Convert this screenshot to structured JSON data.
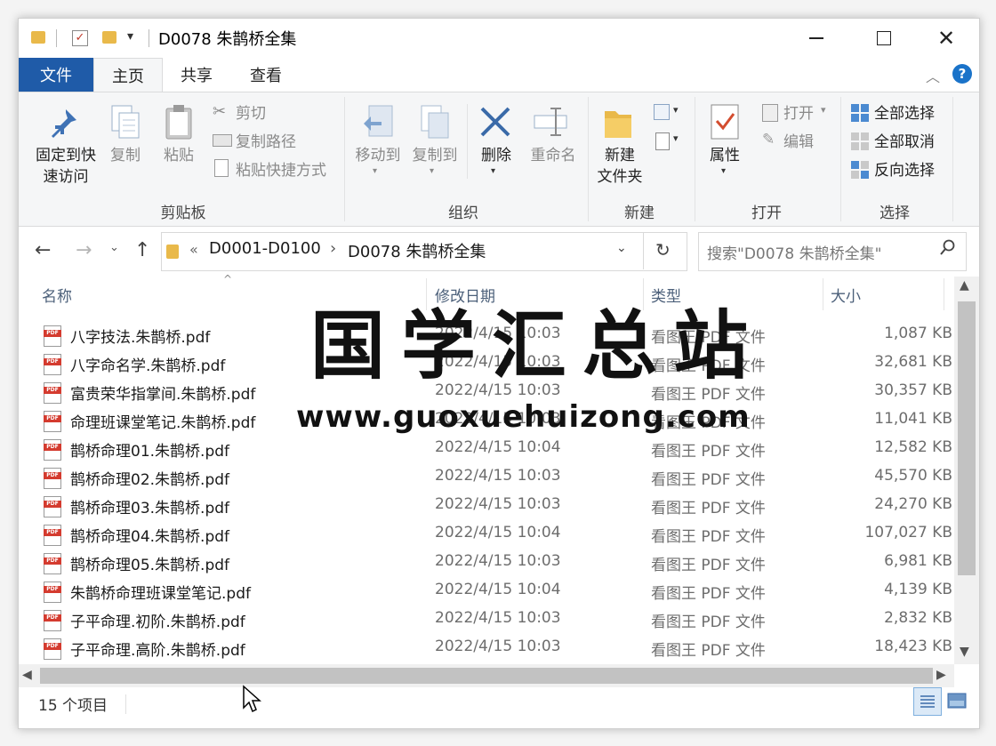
{
  "window": {
    "title": "D0078 朱鹊桥全集"
  },
  "ribbon_tabs": {
    "file": "文件",
    "home": "主页",
    "share": "共享",
    "view": "查看"
  },
  "ribbon": {
    "clipboard": {
      "pin": "固定到快速访问",
      "pin_line1": "固定到快",
      "pin_line2": "速访问",
      "copy": "复制",
      "paste": "粘贴",
      "cut": "剪切",
      "copy_path": "复制路径",
      "paste_shortcut": "粘贴快捷方式",
      "label": "剪贴板"
    },
    "organize": {
      "move_to": "移动到",
      "copy_to": "复制到",
      "delete": "删除",
      "rename": "重命名",
      "label": "组织"
    },
    "new": {
      "new_folder_line1": "新建",
      "new_folder_line2": "文件夹",
      "label": "新建"
    },
    "open": {
      "properties": "属性",
      "open": "打开",
      "edit": "编辑",
      "label": "打开"
    },
    "select": {
      "select_all": "全部选择",
      "select_none": "全部取消",
      "invert": "反向选择",
      "label": "选择"
    }
  },
  "address": {
    "overflow": "«",
    "crumb1": "D0001-D0100",
    "sep": "›",
    "crumb2": "D0078 朱鹊桥全集",
    "search_placeholder": "搜索\"D0078 朱鹊桥全集\""
  },
  "columns": {
    "name": "名称",
    "date": "修改日期",
    "type": "类型",
    "size": "大小"
  },
  "files": [
    {
      "name": "八字技法.朱鹊桥.pdf",
      "date": "2022/4/15 10:03",
      "type": "看图王 PDF 文件",
      "size": "1,087 KB"
    },
    {
      "name": "八字命名学.朱鹊桥.pdf",
      "date": "2022/4/15 10:03",
      "type": "看图王 PDF 文件",
      "size": "32,681 KB"
    },
    {
      "name": "富贵荣华指掌间.朱鹊桥.pdf",
      "date": "2022/4/15 10:03",
      "type": "看图王 PDF 文件",
      "size": "30,357 KB"
    },
    {
      "name": "命理班课堂笔记.朱鹊桥.pdf",
      "date": "2022/4/15 10:03",
      "type": "看图王 PDF 文件",
      "size": "11,041 KB"
    },
    {
      "name": "鹊桥命理01.朱鹊桥.pdf",
      "date": "2022/4/15 10:04",
      "type": "看图王 PDF 文件",
      "size": "12,582 KB"
    },
    {
      "name": "鹊桥命理02.朱鹊桥.pdf",
      "date": "2022/4/15 10:03",
      "type": "看图王 PDF 文件",
      "size": "45,570 KB"
    },
    {
      "name": "鹊桥命理03.朱鹊桥.pdf",
      "date": "2022/4/15 10:03",
      "type": "看图王 PDF 文件",
      "size": "24,270 KB"
    },
    {
      "name": "鹊桥命理04.朱鹊桥.pdf",
      "date": "2022/4/15 10:04",
      "type": "看图王 PDF 文件",
      "size": "107,027 KB"
    },
    {
      "name": "鹊桥命理05.朱鹊桥.pdf",
      "date": "2022/4/15 10:03",
      "type": "看图王 PDF 文件",
      "size": "6,981 KB"
    },
    {
      "name": "朱鹊桥命理班课堂笔记.pdf",
      "date": "2022/4/15 10:04",
      "type": "看图王 PDF 文件",
      "size": "4,139 KB"
    },
    {
      "name": "子平命理.初阶.朱鹊桥.pdf",
      "date": "2022/4/15 10:03",
      "type": "看图王 PDF 文件",
      "size": "2,832 KB"
    },
    {
      "name": "子平命理.高阶.朱鹊桥.pdf",
      "date": "2022/4/15 10:03",
      "type": "看图王 PDF 文件",
      "size": "18,423 KB"
    }
  ],
  "status": {
    "item_count": "15 个项目"
  },
  "watermark": {
    "title": "国学汇总站",
    "url": "www.guoxuehuizong.com"
  },
  "icons": {
    "pdf_badge": "PDF"
  },
  "colors": {
    "file_tab": "#1f5ba8",
    "folder": "#e9b94a",
    "pdf_red": "#d43b2f",
    "help": "#1a73c9"
  }
}
